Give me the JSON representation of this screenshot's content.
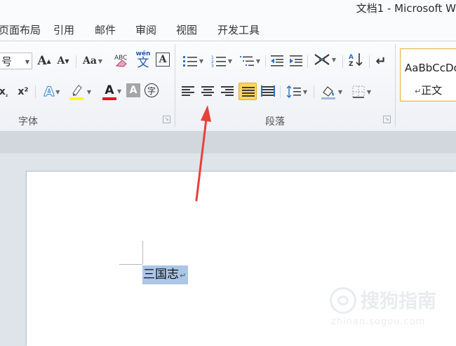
{
  "window": {
    "title": "文档1 - Microsoft W"
  },
  "menu": [
    "页面布局",
    "引用",
    "邮件",
    "审阅",
    "视图",
    "开发工具"
  ],
  "font_group": {
    "label": "字体",
    "font_size_value": "号",
    "grow_font": "A",
    "shrink_font": "A",
    "change_case": "Aa",
    "clear_formatting": "ABC",
    "phonetic_guide": "wén",
    "phonetic_guide_char": "文",
    "char_border": "A",
    "subscript": "x",
    "superscript": "x²",
    "text_effects": "A",
    "highlight": "ab",
    "font_color": "A",
    "char_shading": "A",
    "enclose_char": "字",
    "colors": {
      "highlight": "#ffff00",
      "font_color": "#e81123"
    }
  },
  "paragraph_group": {
    "label": "段落",
    "sort": "A↓Z",
    "show_marks": "↵",
    "active_button": "justify",
    "colors": {
      "active_fill": "#ffd65c"
    }
  },
  "styles_group": {
    "sample_text": "AaBbCcDc",
    "style_name": "正文",
    "style_mark": "↵"
  },
  "document": {
    "selected_text": "三国志",
    "paragraph_mark": "↵",
    "selection_color": "#aac7e8"
  },
  "watermark": {
    "name": "搜狗指南",
    "url": "zhinan.sogou.com"
  },
  "annotation": {
    "arrow_color": "#e8403a"
  }
}
